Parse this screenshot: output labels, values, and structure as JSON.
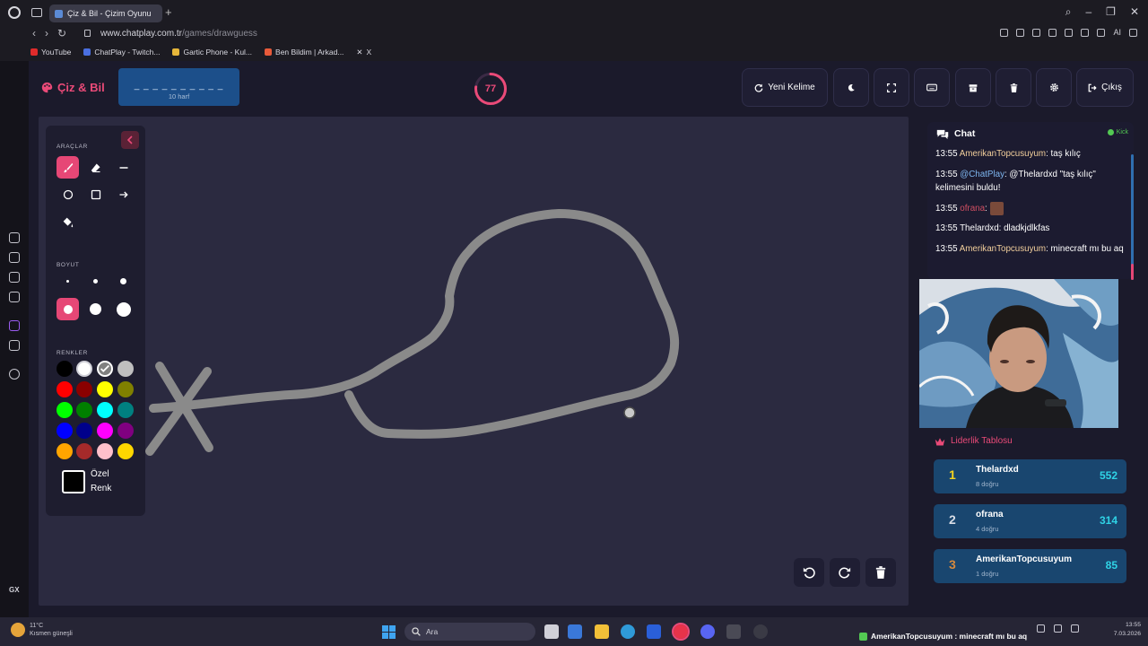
{
  "browser": {
    "tab_title": "Çiz & Bil - Çizim Oyunu",
    "url_host": "www.chatplay.com.tr",
    "url_path": "/games/drawguess",
    "ai_label": "AI",
    "bookmarks": [
      {
        "label": "YouTube",
        "color": "#e02b2b"
      },
      {
        "label": "ChatPlay - Twitch...",
        "color": "#4a6fe0"
      },
      {
        "label": "Gartic Phone - Kul...",
        "color": "#e6b63a"
      },
      {
        "label": "Ben Bildim | Arkad...",
        "color": "#e85a3a"
      },
      {
        "label": "X",
        "color": "#ffffff"
      }
    ]
  },
  "header": {
    "logo": "Çiz & Bil",
    "word_mask": "_ _ _ _ _ _ _ _ _ _",
    "word_length": "10 harf",
    "timer": "77",
    "timer_progress": 0.77,
    "buttons": {
      "new_word": "Yeni Kelime",
      "exit": "Çıkış"
    }
  },
  "tools": {
    "title": "ARAÇLAR",
    "size_title": "BOYUT",
    "colors_title": "RENKLER",
    "custom_color_label": "Özel Renk",
    "colors": [
      "#000000",
      "#ffffff",
      "#808080",
      "#bfbfbf",
      "#ff0000",
      "#8b0000",
      "#ffff00",
      "#808000",
      "#00ff00",
      "#008000",
      "#00ffff",
      "#008080",
      "#0000ff",
      "#00008b",
      "#ff00ff",
      "#800080",
      "#ffa500",
      "#a52a2a",
      "#ffc0cb",
      "#ffd700"
    ],
    "selected_color": "#808080"
  },
  "chat": {
    "title": "Chat",
    "platform": "Kick",
    "messages": [
      {
        "time": "13:55",
        "user": "AmerikanTopcusuyum",
        "text": ": taş kılıç",
        "style": "gold"
      },
      {
        "time": "13:55",
        "user": "@ChatPlay",
        "text": ": @Thelardxd \"taş kılıç\" kelimesini buldu!",
        "style": "blue"
      },
      {
        "time": "13:55",
        "user": "ofrana",
        "text": ":",
        "style": "red"
      },
      {
        "time": "13:55",
        "user": "Thelardxd",
        "text": ": dladkjdlkfas",
        "style": "white"
      },
      {
        "time": "13:55",
        "user": "AmerikanTopcusuyum",
        "text": ": minecraft mı bu aq",
        "style": "gold"
      }
    ]
  },
  "leaderboard": {
    "title": "Liderlik Tablosu",
    "rows": [
      {
        "rank": "1",
        "name": "Thelardxd",
        "sub": "8 doğru",
        "score": "552",
        "rank_color": "#f5d31e"
      },
      {
        "rank": "2",
        "name": "ofrana",
        "sub": "4 doğru",
        "score": "314",
        "rank_color": "#d8dde6"
      },
      {
        "rank": "3",
        "name": "AmerikanTopcusuyum",
        "sub": "1 doğru",
        "score": "85",
        "rank_color": "#d68a3e"
      }
    ]
  },
  "taskbar": {
    "weather_temp": "11°C",
    "weather_desc": "Kısmen güneşli",
    "search_label": "Ara",
    "notification": "AmerikanTopcusuyum : minecraft mı bu aq",
    "time": "13:55",
    "date": "7.03.2026"
  }
}
